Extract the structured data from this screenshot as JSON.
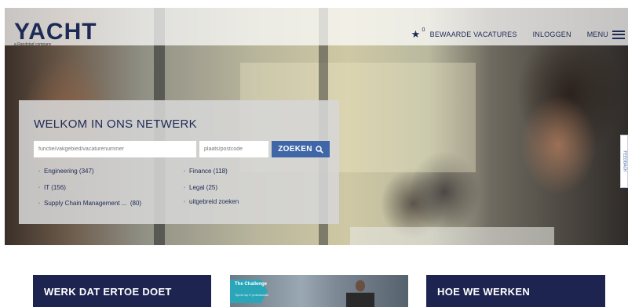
{
  "header": {
    "logo": "YACHT",
    "tagline": "a Randstad company",
    "saved_count": "0",
    "saved_jobs_label": "BEWAARDE VACATURES",
    "login_label": "INLOGGEN",
    "menu_label": "MENU"
  },
  "search": {
    "title": "WELKOM IN ONS NETWERK",
    "what_placeholder": "functie/vakgebied/vacaturenummer",
    "where_placeholder": "plaats/postcode",
    "button_label": "ZOEKEN",
    "categories_left": [
      "Engineering (347)",
      "IT (156)",
      "Supply Chain Management ...  (80)"
    ],
    "categories_right": [
      "Finance (118)",
      "Legal (25)",
      "uitgebreid zoeken"
    ]
  },
  "feedback": {
    "label": "FEEDBACK"
  },
  "cards": [
    {
      "title": "WERK DAT ERTOE DOET"
    },
    {
      "tag_title": "The Challenge",
      "tag_sub": "Tips for top IT professionals"
    },
    {
      "title": "HOE WE WERKEN"
    }
  ],
  "colors": {
    "brand_navy": "#1c2a55",
    "button_blue": "#3f67a7",
    "card_navy": "#1d2450",
    "challenge_teal": "#2aa6b8"
  }
}
